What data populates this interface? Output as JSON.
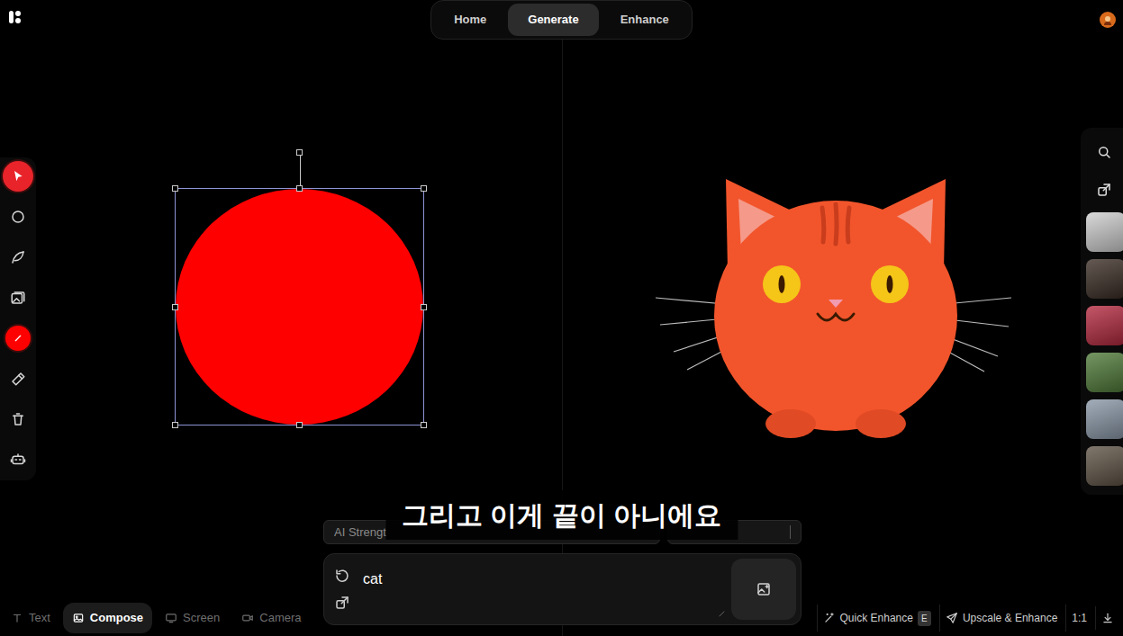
{
  "nav": {
    "tabs": [
      {
        "label": "Home",
        "selected": false
      },
      {
        "label": "Generate",
        "selected": true
      },
      {
        "label": "Enhance",
        "selected": false
      }
    ]
  },
  "toolbar": {
    "tools": [
      {
        "kind": "select",
        "selected": true
      },
      {
        "kind": "circle",
        "selected": false
      },
      {
        "kind": "pen",
        "selected": false
      },
      {
        "kind": "image",
        "selected": false
      },
      {
        "kind": "color",
        "selected": false
      },
      {
        "kind": "eraser",
        "selected": false
      },
      {
        "kind": "trash",
        "selected": false
      },
      {
        "kind": "robot",
        "selected": false
      }
    ]
  },
  "brush": {
    "color": "#ff0000"
  },
  "canvas": {
    "shape_selected": true
  },
  "rail": {
    "tools": [
      {
        "kind": "search"
      },
      {
        "kind": "share"
      }
    ],
    "thumbnails": [
      {
        "color": "#cfcfcf"
      },
      {
        "color": "#3a2c24"
      },
      {
        "color": "#b4283e"
      },
      {
        "color": "#4f7a38"
      },
      {
        "color": "#8a98a8"
      },
      {
        "color": "#5e5244"
      }
    ]
  },
  "controls": {
    "strength_label": "AI Strengt"
  },
  "prompt": {
    "value": "cat"
  },
  "modes": [
    {
      "kind": "text",
      "label": "Text",
      "selected": false
    },
    {
      "kind": "compose",
      "label": "Compose",
      "selected": true
    },
    {
      "kind": "screen",
      "label": "Screen",
      "selected": false
    },
    {
      "kind": "camera",
      "label": "Camera",
      "selected": false
    }
  ],
  "actions": [
    {
      "kind": "enhance",
      "label": "Quick Enhance",
      "key": "E"
    },
    {
      "kind": "upscale",
      "label": "Upscale & Enhance"
    },
    {
      "kind": "ratio",
      "label": "1:1"
    },
    {
      "kind": "download"
    }
  ],
  "caption": "그리고 이게 끝이 아니에요"
}
